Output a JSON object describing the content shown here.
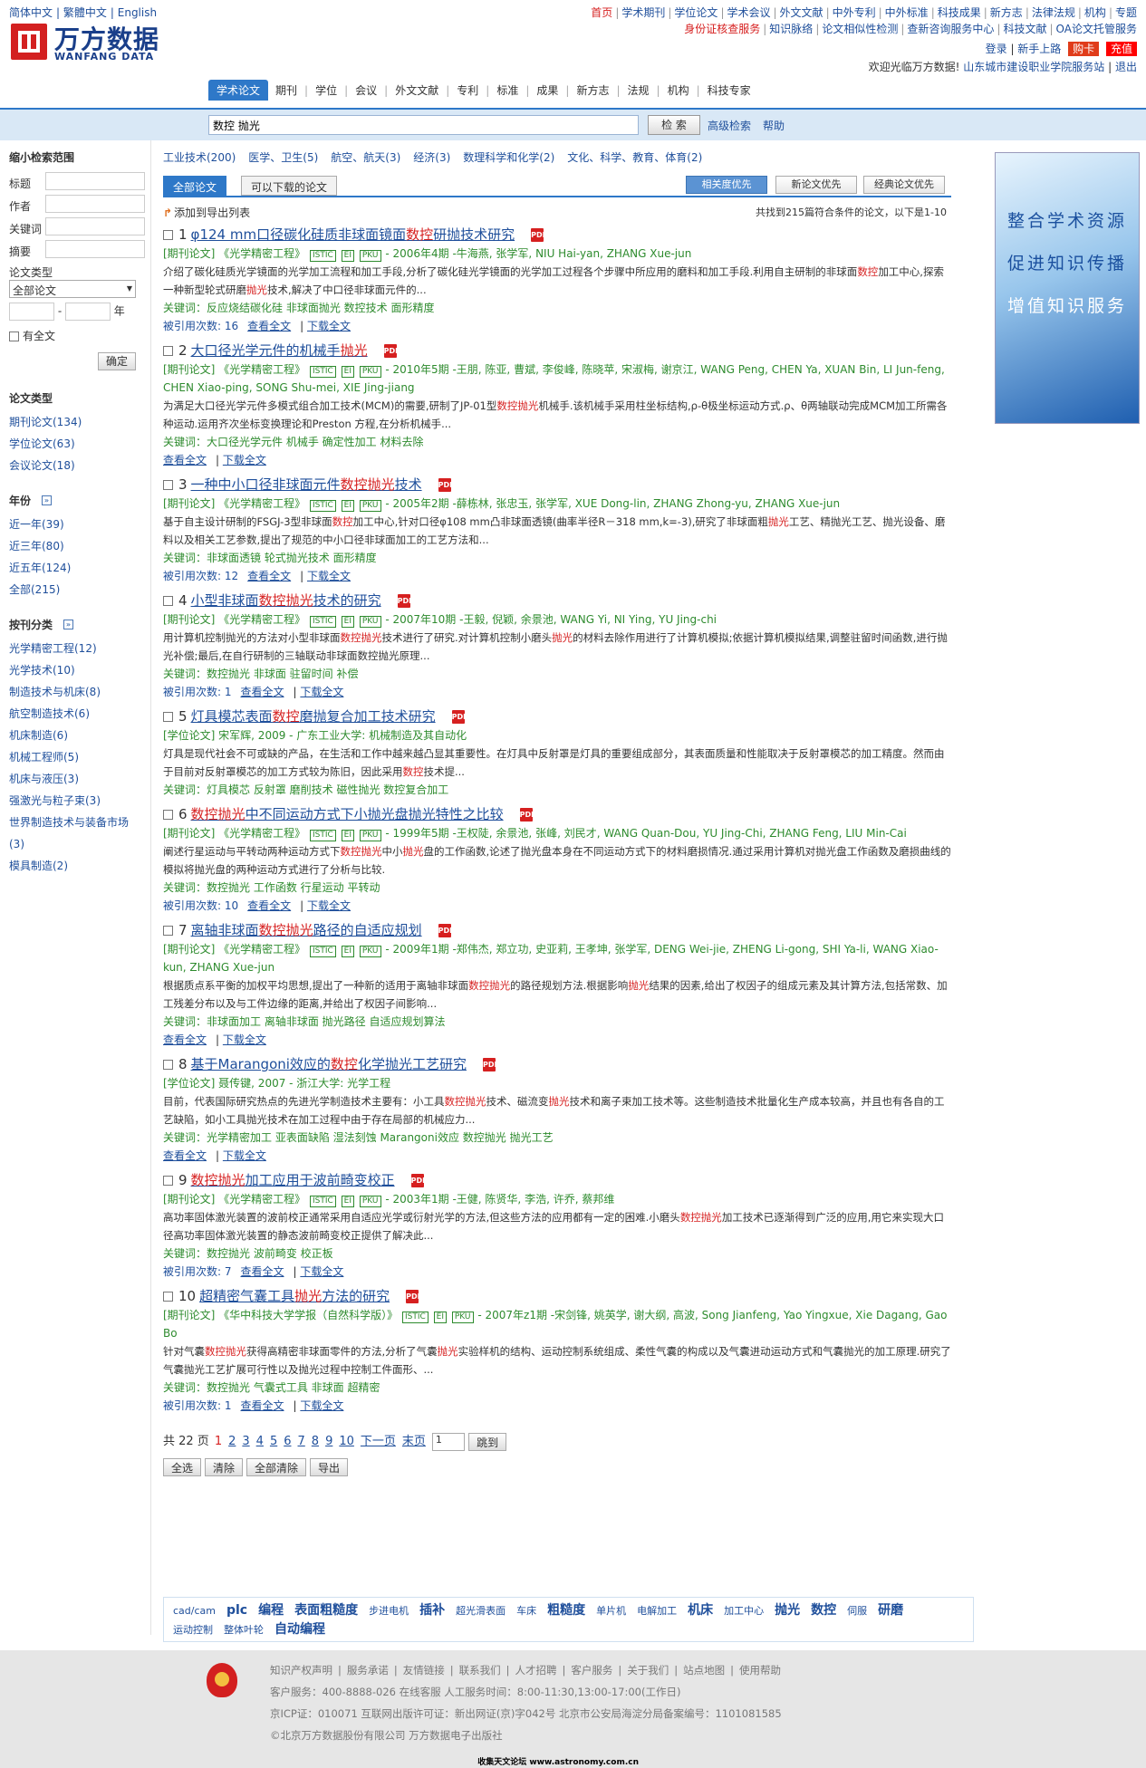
{
  "header": {
    "langs": [
      "简体中文",
      "繁體中文",
      "English"
    ],
    "logo_cn": "万方数据",
    "logo_en": "WANFANG DATA",
    "toplinks1": [
      "首页",
      "学术期刊",
      "学位论文",
      "学术会议",
      "外文文献",
      "中外专利",
      "中外标准",
      "科技成果",
      "新方志",
      "法律法规",
      "机构",
      "专题"
    ],
    "toplinks2": [
      "身份证核查服务",
      "知识脉络",
      "论文相似性检测",
      "查新咨询服务中心",
      "科技文献",
      "OA论文托管服务"
    ],
    "login": "登录",
    "guide": "新手上路",
    "card": "购卡",
    "recharge": "充值",
    "welcome": "欢迎光临万方数据!",
    "org": "山东城市建设职业学院服务站",
    "logout": "退出"
  },
  "nav": [
    "学术论文",
    "期刊",
    "学位",
    "会议",
    "外文文献",
    "专利",
    "标准",
    "成果",
    "新方志",
    "法规",
    "机构",
    "科技专家"
  ],
  "search": {
    "value": "数控 抛光",
    "button": "检 索",
    "advanced": "高级检索",
    "help": "帮助"
  },
  "sidebar": {
    "title": "缩小检索范围",
    "fields": [
      "标题",
      "作者",
      "关键词",
      "摘要"
    ],
    "doctype_label": "论文类型",
    "doctype_selected": "全部论文",
    "year_unit": "年",
    "fulltext": "有全文",
    "confirm": "确定",
    "types_title": "论文类型",
    "types": [
      "期刊论文(134)",
      "学位论文(63)",
      "会议论文(18)"
    ],
    "year_title": "年份",
    "years": [
      "近一年(39)",
      "近三年(80)",
      "近五年(124)",
      "全部(215)"
    ],
    "journal_title": "按刊分类",
    "journals": [
      "光学精密工程(12)",
      "光学技术(10)",
      "制造技术与机床(8)",
      "航空制造技术(6)",
      "机床制造(6)",
      "机械工程师(5)",
      "机床与液压(3)",
      "强激光与粒子束(3)",
      "世界制造技术与装备市场",
      "(3)",
      "模具制造(2)"
    ]
  },
  "main": {
    "cats": [
      "工业技术(200)",
      "医学、卫生(5)",
      "航空、航天(3)",
      "经济(3)",
      "数理科学和化学(2)",
      "文化、科学、教育、体育(2)"
    ],
    "tab_all": "全部论文",
    "tab_dl": "可以下载的论文",
    "sort": [
      "相关度优先",
      "新论文优先",
      "经典论文优先"
    ],
    "export": "添加到导出列表",
    "found": "共找到215篇符合条件的论文，以下是1-10",
    "records": [
      {
        "n": "1",
        "title": [
          "φ124 mm口径碳化硅质非球面镜面",
          "数控",
          "研抛技术研究"
        ],
        "meta": "[期刊论文] 《光学精密工程》",
        "badges": [
          "ISTIC",
          "EI",
          "PKU"
        ],
        "meta2": "- 2006年4期 -牛海燕, 张学军, NIU Hai-yan, ZHANG Xue-jun",
        "abs": [
          "介绍了碳化硅质光学镜面的光学加工流程和加工手段,分析了碳化硅光学镜面的光学加工过程各个步骤中所应用的磨料和加工手段.利用自主研制的非球面",
          "数控",
          "加工中心,探索一种新型轮式研磨",
          "抛光",
          "技术,解决了中口径非球面元件的..."
        ],
        "kw": "关键词：反应烧结碳化硅 非球面抛光 数控技术 面形精度",
        "cited": "被引用次数: 16",
        "view": "查看全文",
        "dl": "下载全文"
      },
      {
        "n": "2",
        "title": [
          "大口径光学元件的机械手",
          "抛光",
          ""
        ],
        "meta": "[期刊论文] 《光学精密工程》",
        "badges": [
          "ISTIC",
          "EI",
          "PKU"
        ],
        "meta2": "- 2010年5期 -王朋, 陈亚, 曹斌, 李俊峰, 陈晓苹, 宋淑梅, 谢京江, WANG Peng, CHEN Ya, XUAN Bin, LI Jun-feng, CHEN Xiao-ping, SONG Shu-mei, XIE Jing-jiang",
        "abs": [
          "为满足大口径光学元件多模式组合加工技术(MCM)的需要,研制了JP-01型",
          "数控抛光",
          "机械手.该机械手采用柱坐标结构,ρ-θ极坐标运动方式.ρ、θ两轴联动完成MCM加工所需各种运动.运用齐次坐标变换理论和Preston 方程,在分析机械手...",
          ""
        ],
        "kw": "关键词：大口径光学元件 机械手 确定性加工 材料去除",
        "cited": "",
        "view": "查看全文",
        "dl": "下载全文"
      },
      {
        "n": "3",
        "title": [
          "一种中小口径非球面元件",
          "数控抛光",
          "技术"
        ],
        "meta": "[期刊论文] 《光学精密工程》",
        "badges": [
          "ISTIC",
          "EI",
          "PKU"
        ],
        "meta2": "- 2005年2期 -薛栋林, 张忠玉, 张学军, XUE Dong-lin, ZHANG Zhong-yu, ZHANG Xue-jun",
        "abs": [
          "基于自主设计研制的FSGJ-3型非球面",
          "数控",
          "加工中心,针对口径φ108 mm凸非球面透镜(曲率半径R－318 mm,k=-3),研究了非球面粗",
          "抛光",
          "工艺、精抛光工艺、抛光设备、磨料以及相关工艺参数,提出了规范的中小口径非球面加工的工艺方法和..."
        ],
        "kw": "关键词：非球面透镜 轮式抛光技术 面形精度",
        "cited": "被引用次数: 12",
        "view": "查看全文",
        "dl": "下载全文"
      },
      {
        "n": "4",
        "title": [
          "小型非球面",
          "数控抛光",
          "技术的研究"
        ],
        "meta": "[期刊论文] 《光学精密工程》",
        "badges": [
          "ISTIC",
          "EI",
          "PKU"
        ],
        "meta2": "- 2007年10期 -王毅, 倪颖, 余景池, WANG Yi, NI Ying, YU Jing-chi",
        "abs": [
          "用计算机控制抛光的方法对小型非球面",
          "数控抛光",
          "技术进行了研究.对计算机控制小磨头",
          "抛光",
          "的材料去除作用进行了计算机模拟;依据计算机模拟结果,调整驻留时间函数,进行抛光补偿;最后,在自行研制的三轴联动非球面数控抛光原理..."
        ],
        "kw": "关键词：数控抛光 非球面 驻留时间 补偿",
        "cited": "被引用次数: 1",
        "view": "查看全文",
        "dl": "下载全文"
      },
      {
        "n": "5",
        "title": [
          "灯具模芯表面",
          "数控",
          "磨抛复合加工技术研究"
        ],
        "meta": "[学位论文] 宋军辉, 2009 - 广东工业大学: 机械制造及其自动化",
        "badges": [],
        "meta2": "",
        "abs": [
          "灯具是现代社会不可或缺的产品，在生活和工作中越来越凸显其重要性。在灯具中反射罩是灯具的重要组成部分，其表面质量和性能取决于反射罩模芯的加工精度。然而由于目前对反射罩模芯的加工方式较为陈旧，因此采用",
          "数控",
          "技术提...",
          "",
          ""
        ],
        "kw": "关键词：灯具模芯 反射罩 磨削技术 磁性抛光 数控复合加工",
        "cited": "",
        "view": "",
        "dl": ""
      },
      {
        "n": "6",
        "title": [
          "",
          "数控抛光",
          "中不同运动方式下小抛光盘抛光特性之比较"
        ],
        "meta": "[期刊论文] 《光学精密工程》",
        "badges": [
          "ISTIC",
          "EI",
          "PKU"
        ],
        "meta2": "- 1999年5期 -王权陡, 余景池, 张峰, 刘民才, WANG Quan-Dou, YU Jing-Chi, ZHANG Feng, LIU Min-Cai",
        "abs": [
          "阐述行星运动与平转动两种运动方式下",
          "数控抛光",
          "中小",
          "抛光",
          "盘的工作函数,论述了抛光盘本身在不同运动方式下的材料磨损情况.通过采用计算机对抛光盘工作函数及磨损曲线的模拟将抛光盘的两种运动方式进行了分析与比较."
        ],
        "kw": "关键词：数控抛光 工作函数 行星运动 平转动",
        "cited": "被引用次数: 10",
        "view": "查看全文",
        "dl": "下载全文"
      },
      {
        "n": "7",
        "title": [
          "离轴非球面",
          "数控抛光",
          "路径的自适应规划"
        ],
        "meta": "[期刊论文] 《光学精密工程》",
        "badges": [
          "ISTIC",
          "EI",
          "PKU"
        ],
        "meta2": "- 2009年1期 -郑伟杰, 郑立功, 史亚莉, 王孝坤, 张学军, DENG Wei-jie, ZHENG Li-gong, SHI Ya-li, WANG Xiao-kun, ZHANG Xue-jun",
        "abs": [
          "根据质点系平衡的加权平均思想,提出了一种新的适用于离轴非球面",
          "数控抛光",
          "的路径规划方法.根据影响",
          "抛光",
          "结果的因素,给出了权因子的组成元素及其计算方法,包括常数、加工残差分布以及与工件边缘的距离,并给出了权因子间影响..."
        ],
        "kw": "关键词：非球面加工 离轴非球面 抛光路径 自适应规划算法",
        "cited": "",
        "view": "查看全文",
        "dl": "下载全文"
      },
      {
        "n": "8",
        "title": [
          "基于Marangoni效应的",
          "数控",
          "化学抛光工艺研究"
        ],
        "meta": "[学位论文] 聂传键, 2007 - 浙江大学: 光学工程",
        "badges": [],
        "meta2": "",
        "abs": [
          "目前，代表国际研究热点的先进光学制造技术主要有：小工具",
          "数控抛光",
          "技术、磁流变",
          "抛光",
          "技术和离子束加工技术等。这些制造技术批量化生产成本较高，并且也有各自的工艺缺陷，如小工具抛光技术在加工过程中由于存在局部的机械应力..."
        ],
        "kw": "关键词：光学精密加工 亚表面缺陷 湿法刻蚀 Marangoni效应 数控抛光 抛光工艺",
        "cited": "",
        "view": "查看全文",
        "dl": "下载全文"
      },
      {
        "n": "9",
        "title": [
          "",
          "数控抛光",
          "加工应用于波前畸变校正"
        ],
        "meta": "[期刊论文] 《光学精密工程》",
        "badges": [
          "ISTIC",
          "EI",
          "PKU"
        ],
        "meta2": "- 2003年1期 -王健, 陈贤华, 李浩, 许乔, 蔡邦维",
        "abs": [
          "高功率固体激光装置的波前校正通常采用自适应光学或衍射光学的方法,但这些方法的应用都有一定的困难.小磨头",
          "数控抛光",
          "加工技术已逐渐得到广泛的应用,用它来实现大口径高功率固体激光装置的静态波前畸变校正提供了解决此...",
          "",
          ""
        ],
        "kw": "关键词：数控抛光 波前畸变 校正板",
        "cited": "被引用次数: 7",
        "view": "查看全文",
        "dl": "下载全文"
      },
      {
        "n": "10",
        "title": [
          "超精密气囊工具",
          "抛光",
          "方法的研究"
        ],
        "meta": "[期刊论文] 《华中科技大学学报（自然科学版）》",
        "badges": [
          "ISTIC",
          "EI",
          "PKU"
        ],
        "meta2": "- 2007年z1期 -宋剑锋, 姚英学, 谢大纲, 高波, Song Jianfeng, Yao Yingxue, Xie Dagang, Gao Bo",
        "abs": [
          "针对气囊",
          "数控抛光",
          "获得高精密非球面零件的方法,分析了气囊",
          "抛光",
          "实验样机的结构、运动控制系统组成、柔性气囊的构成以及气囊进动运动方式和气囊抛光的加工原理.研究了气囊抛光工艺扩展可行性以及抛光过程中控制工件面形、..."
        ],
        "kw": "关键词：数控抛光 气囊式工具 非球面 超精密",
        "cited": "被引用次数: 1",
        "view": "查看全文",
        "dl": "下载全文"
      }
    ],
    "pager": {
      "total": "共 22 页",
      "pages": [
        "1",
        "2",
        "3",
        "4",
        "5",
        "6",
        "7",
        "8",
        "9",
        "10"
      ],
      "next": "下一页",
      "last": "末页",
      "box": "1",
      "jump": "跳到"
    },
    "bottom_buttons": [
      "全选",
      "清除",
      "全部清除",
      "导出"
    ],
    "tags": [
      "cad/cam",
      "plc",
      "编程",
      "表面粗糙度",
      "步进电机",
      "插补",
      "超光滑表面",
      "车床",
      "粗糙度",
      "单片机",
      "电解加工",
      "机床",
      "加工中心",
      "抛光",
      "数控",
      "伺服",
      "研磨",
      "运动控制",
      "整体叶轮",
      "自动编程"
    ]
  },
  "ad": [
    "整合学术资源",
    "促进知识传播",
    "增值知识服务"
  ],
  "footer": {
    "links": [
      "知识产权声明",
      "服务承诺",
      "友情链接",
      "联系我们",
      "人才招聘",
      "客户服务",
      "关于我们",
      "站点地图",
      "使用帮助"
    ],
    "service": "客户服务：400-8888-026 在线客服  人工服务时间：8:00-11:30,13:00-17:00(工作日)",
    "icp": "京ICP证：010071 互联网出版许可证：新出网证(京)字042号 北京市公安局海淀分局备案编号：1101081585",
    "copy": "©北京万方数据股份有限公司 万方数据电子出版社",
    "credit": "收集天文论坛 www.astronomy.com.cn"
  }
}
